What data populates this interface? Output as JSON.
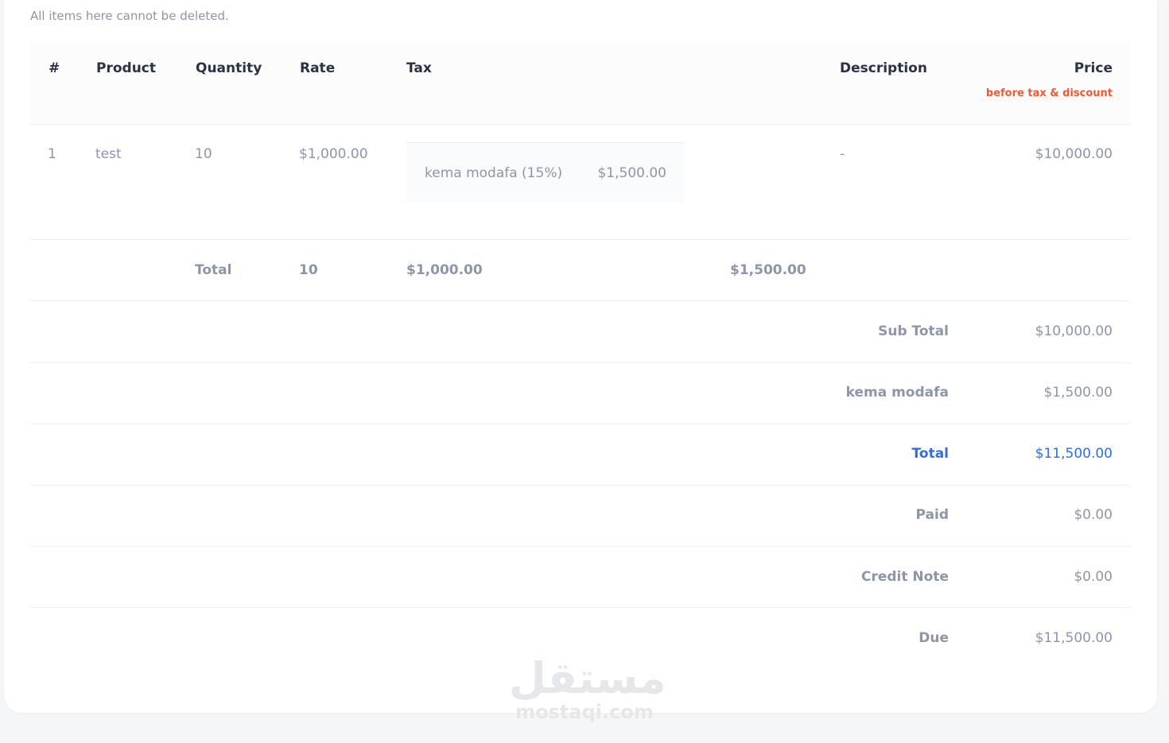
{
  "note": "All items here cannot be deleted.",
  "table": {
    "headers": {
      "index": "#",
      "product": "Product",
      "quantity": "Quantity",
      "rate": "Rate",
      "tax": "Tax",
      "description": "Description",
      "price": "Price",
      "price_sub": "before tax & discount"
    },
    "rows": [
      {
        "index": "1",
        "product": "test",
        "quantity": "10",
        "rate": "$1,000.00",
        "tax_name": "kema modafa (15%)",
        "tax_amount": "$1,500.00",
        "description": "-",
        "price": "$10,000.00"
      }
    ],
    "totals_row": {
      "label": "Total",
      "quantity": "10",
      "rate": "$1,000.00",
      "tax": "$1,500.00"
    }
  },
  "summary": [
    {
      "label": "Sub Total",
      "value": "$10,000.00"
    },
    {
      "label": "kema modafa",
      "value": "$1,500.00"
    },
    {
      "label": "Total",
      "value": "$11,500.00"
    },
    {
      "label": "Paid",
      "value": "$0.00"
    },
    {
      "label": "Credit Note",
      "value": "$0.00"
    },
    {
      "label": "Due",
      "value": "$11,500.00"
    }
  ],
  "watermark": {
    "arabic": "مستقل",
    "latin": "mostaqi.com"
  },
  "colors": {
    "accent": "#2f6fe0",
    "warning": "#ef5a36",
    "muted_text": "#8d96a8",
    "heading_text": "#2a3243"
  }
}
